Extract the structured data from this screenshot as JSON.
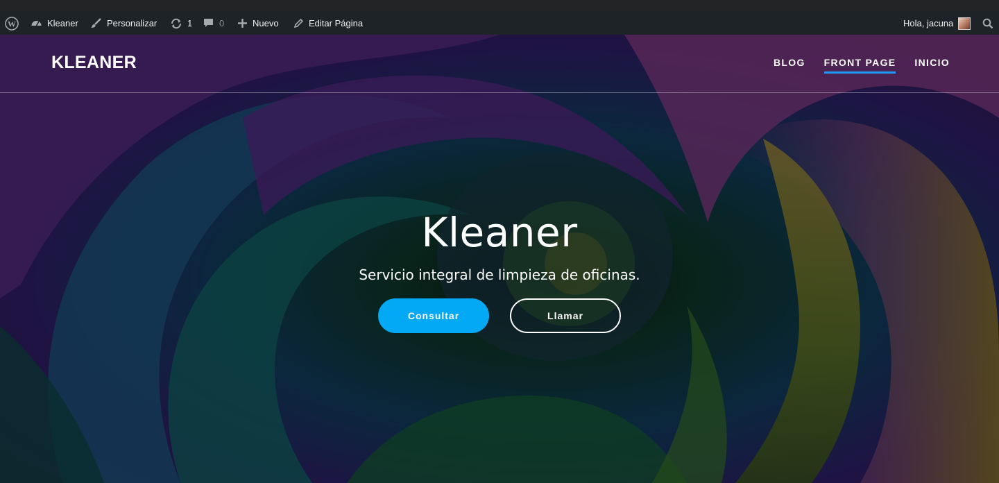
{
  "admin_bar": {
    "site_name": "Kleaner",
    "customize_label": "Personalizar",
    "updates_count": "1",
    "comments_count": "0",
    "new_label": "Nuevo",
    "edit_label": "Editar Página",
    "greeting": "Hola, jacuna"
  },
  "header": {
    "site_title": "KLEANER",
    "nav": [
      {
        "label": "BLOG",
        "active": false
      },
      {
        "label": "FRONT PAGE",
        "active": true
      },
      {
        "label": "INICIO",
        "active": false
      }
    ]
  },
  "hero": {
    "title": "Kleaner",
    "subtitle": "Servicio integral de limpieza de oficinas.",
    "primary_button": "Consultar",
    "secondary_button": "Llamar"
  },
  "colors": {
    "admin_bar_bg": "#1d2327",
    "accent": "#03a9f4",
    "nav_underline": "#1e9bff"
  },
  "icons": [
    "wordpress-icon",
    "dashboard-icon",
    "brush-icon",
    "update-icon",
    "comment-icon",
    "plus-icon",
    "pencil-icon",
    "avatar",
    "search-icon"
  ]
}
